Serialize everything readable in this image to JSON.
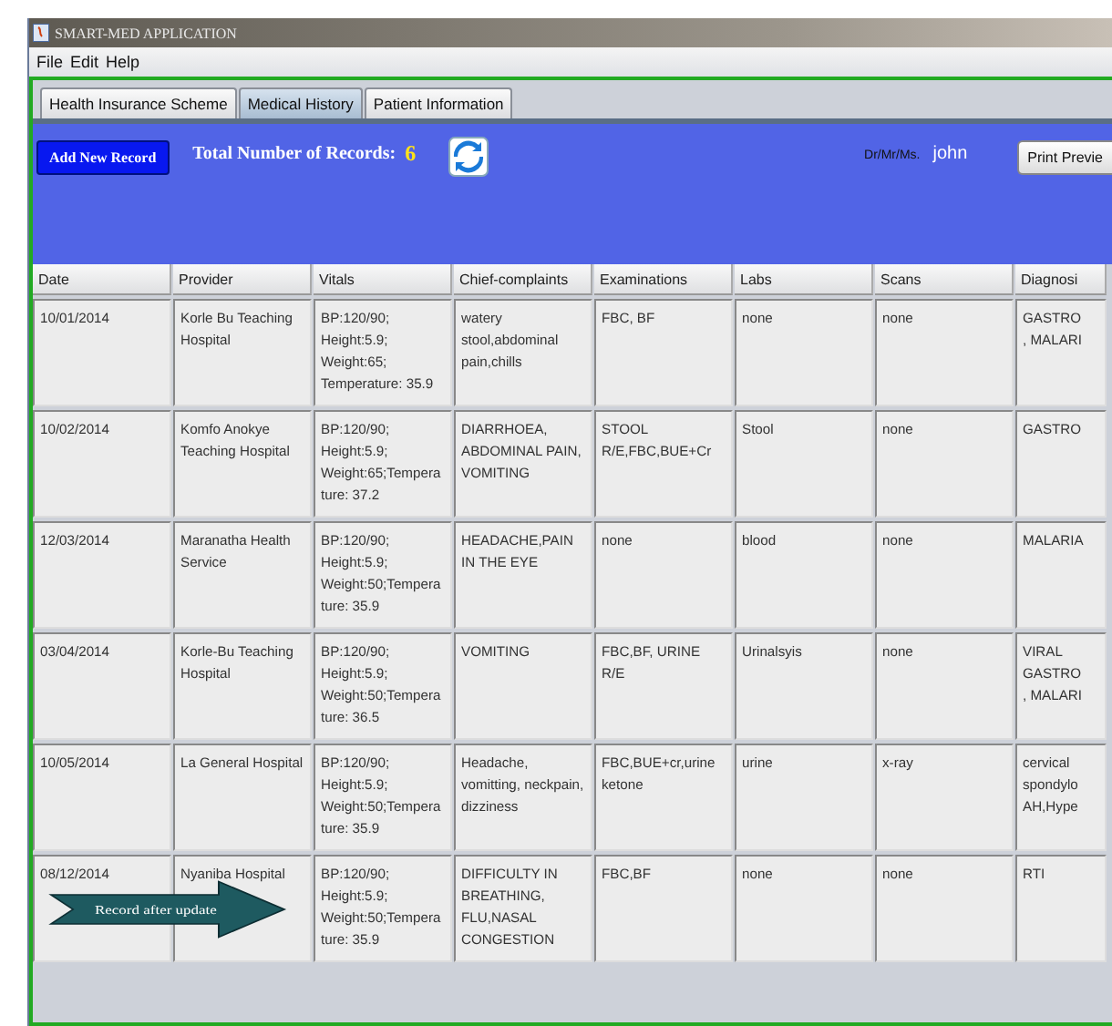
{
  "window": {
    "title": "SMART-MED APPLICATION"
  },
  "menu": [
    "File",
    "Edit",
    "Help"
  ],
  "tabs": [
    {
      "label": "Health Insurance Scheme",
      "selected": false
    },
    {
      "label": "Medical History",
      "selected": true
    },
    {
      "label": "Patient Information",
      "selected": false
    }
  ],
  "toolbar": {
    "add_button": "Add New Record",
    "total_label": "Total Number of Records:",
    "total_value": "6",
    "user_label": "Dr/Mr/Ms.",
    "user_name": "john",
    "print_button": "Print Previe"
  },
  "table": {
    "columns": [
      "Date",
      "Provider",
      "Vitals",
      "Chief-complaints",
      "Examinations",
      "Labs",
      "Scans",
      "Diagnosi"
    ],
    "rows": [
      [
        "10/01/2014",
        "Korle Bu Teaching Hospital",
        "BP:120/90; Height:5.9; Weight:65; Temperature: 35.9",
        "watery stool,abdominal pain,chills",
        "FBC, BF",
        "none",
        "none",
        "GASTRO\n, MALARI"
      ],
      [
        "10/02/2014",
        "Komfo Anokye Teaching Hospital",
        "BP:120/90; Height:5.9; Weight:65;Tempera ture: 37.2",
        "DIARRHOEA, ABDOMINAL PAIN, VOMITING",
        "STOOL R/E,FBC,BUE+Cr",
        "Stool",
        "none",
        "GASTRO"
      ],
      [
        "12/03/2014",
        "Maranatha Health Service",
        "BP:120/90; Height:5.9; Weight:50;Tempera ture: 35.9",
        "HEADACHE,PAIN IN THE EYE",
        "none",
        "blood",
        "none",
        "MALARIA"
      ],
      [
        "03/04/2014",
        "Korle-Bu Teaching Hospital",
        "BP:120/90; Height:5.9; Weight:50;Tempera ture: 36.5",
        "VOMITING",
        "FBC,BF, URINE R/E",
        "Urinalsyis",
        "none",
        "VIRAL\nGASTRO\n, MALARI"
      ],
      [
        "10/05/2014",
        "La General Hospital",
        "BP:120/90; Height:5.9; Weight:50;Tempera ture: 35.9",
        "Headache, vomitting, neckpain, dizziness",
        "FBC,BUE+cr,urine ketone",
        "urine",
        "x-ray",
        "cervical\nspondylo\nAH,Hype"
      ],
      [
        "08/12/2014",
        "Nyaniba Hospital",
        "BP:120/90; Height:5.9; Weight:50;Tempera ture: 35.9",
        "DIFFICULTY IN BREATHING, FLU,NASAL CONGESTION",
        "FBC,BF",
        "none",
        "none",
        "RTI"
      ]
    ]
  },
  "callout": {
    "text": "Record after update"
  }
}
